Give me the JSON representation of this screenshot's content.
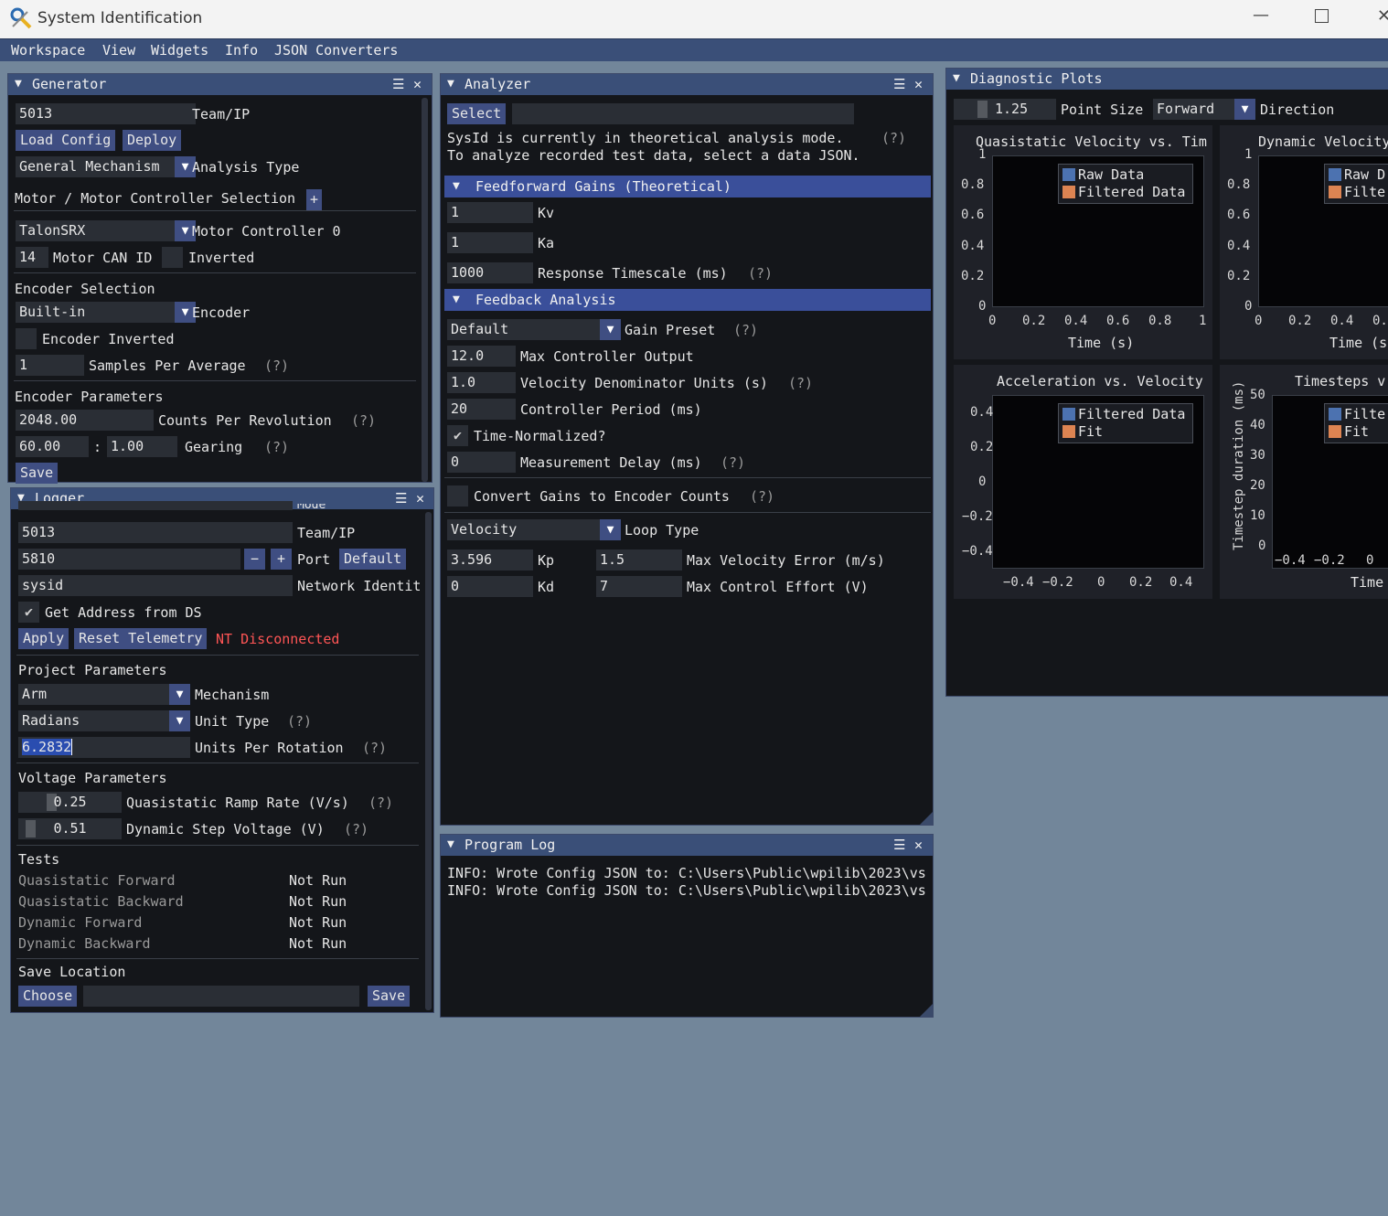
{
  "app": {
    "title": "System Identification"
  },
  "menu": [
    "Workspace",
    "View",
    "Widgets",
    "Info",
    "JSON Converters"
  ],
  "colors": {
    "accent": "#3a4f78",
    "button": "#3f4e82",
    "raw_series": "#4c72b0",
    "filtered_series": "#dd8452",
    "error_text": "#ff5555"
  },
  "generator": {
    "title": "Generator",
    "team_value": "5013",
    "team_label": "Team/IP",
    "load_config": "Load Config",
    "deploy": "Deploy",
    "analysis_type_value": "General Mechanism",
    "analysis_type_label": "Analysis Type",
    "motor_section": "Motor / Motor Controller Selection",
    "add": "+",
    "motor_controller_value": "TalonSRX",
    "motor_controller_label": "Motor Controller 0",
    "can_id_value": "14",
    "can_id_label": "Motor CAN ID",
    "inverted_label": "Inverted",
    "encoder_section": "Encoder Selection",
    "encoder_value": "Built-in",
    "encoder_label": "Encoder",
    "encoder_inverted_label": "Encoder Inverted",
    "samples_value": "1",
    "samples_label": "Samples Per Average",
    "help": "(?)",
    "encoder_params": "Encoder Parameters",
    "cpr_value": "2048.00",
    "cpr_label": "Counts Per Revolution",
    "gear_a": "60.00",
    "gear_sep": ":",
    "gear_b": "1.00",
    "gearing_label": "Gearing",
    "save": "Save"
  },
  "logger": {
    "title": "Logger",
    "partial_text": "Mode",
    "team_value": "5013",
    "team_label": "Team/IP",
    "port_value": "5810",
    "minus": "−",
    "plus": "+",
    "port_label": "Port",
    "default": "Default",
    "nt_value": "sysid",
    "nt_label": "Network Identit",
    "ds_label": "Get Address from DS",
    "apply": "Apply",
    "reset": "Reset Telemetry",
    "nt_status": "NT Disconnected",
    "project_params": "Project Parameters",
    "mechanism_value": "Arm",
    "mechanism_label": "Mechanism",
    "unit_type_value": "Radians",
    "unit_type_label": "Unit Type",
    "help": "(?)",
    "upr_value": "6.2832",
    "upr_label": "Units Per Rotation",
    "voltage_params": "Voltage Parameters",
    "ramp_value": "0.25",
    "ramp_label": "Quasistatic Ramp Rate (V/s)",
    "step_value": "0.51",
    "step_label": "Dynamic Step Voltage (V)",
    "tests_label": "Tests",
    "tests": [
      {
        "name": "Quasistatic Forward",
        "status": "Not Run"
      },
      {
        "name": "Quasistatic Backward",
        "status": "Not Run"
      },
      {
        "name": "Dynamic Forward",
        "status": "Not Run"
      },
      {
        "name": "Dynamic Backward",
        "status": "Not Run"
      }
    ],
    "save_location": "Save Location",
    "choose": "Choose",
    "save": "Save"
  },
  "analyzer": {
    "title": "Analyzer",
    "select": "Select",
    "mode_line1": "SysId is currently in theoretical analysis mode.",
    "mode_line2": "To analyze recorded test data, select a data JSON.",
    "help": "(?)",
    "ff_header": "Feedforward Gains (Theoretical)",
    "kv_value": "1",
    "kv_label": "Kv",
    "ka_value": "1",
    "ka_label": "Ka",
    "rt_value": "1000",
    "rt_label": "Response Timescale (ms)",
    "fb_header": "Feedback Analysis",
    "preset_value": "Default",
    "preset_label": "Gain Preset",
    "mco_value": "12.0",
    "mco_label": "Max Controller Output",
    "vdu_value": "1.0",
    "vdu_label": "Velocity Denominator Units (s)",
    "cp_value": "20",
    "cp_label": "Controller Period (ms)",
    "tn_label": "Time-Normalized?",
    "md_value": "0",
    "md_label": "Measurement Delay (ms)",
    "convert_label": "Convert Gains to Encoder Counts",
    "loop_value": "Velocity",
    "loop_label": "Loop Type",
    "kp_value": "3.596",
    "kp_label": "Kp",
    "mve_value": "1.5",
    "mve_label": "Max Velocity Error (m/s)",
    "kd_value": "0",
    "kd_label": "Kd",
    "mce_value": "7",
    "mce_label": "Max Control Effort (V)"
  },
  "program_log": {
    "title": "Program Log",
    "lines": [
      "INFO: Wrote Config JSON to: C:\\Users\\Public\\wpilib\\2023\\vs",
      "INFO: Wrote Config JSON to: C:\\Users\\Public\\wpilib\\2023\\vs"
    ]
  },
  "diagnostics": {
    "title": "Diagnostic Plots",
    "point_size_value": "1.25",
    "point_size_label": "Point Size",
    "direction_value": "Forward",
    "direction_label": "Direction",
    "plots": [
      {
        "title": "Quasistatic Velocity vs. Tim",
        "xlabel": "Time (s)",
        "xticks": [
          "0",
          "0.2",
          "0.4",
          "0.6",
          "0.8",
          "1"
        ],
        "yticks": [
          "1",
          "0.8",
          "0.6",
          "0.4",
          "0.2",
          "0"
        ],
        "legend": [
          "Raw Data",
          "Filtered Data"
        ]
      },
      {
        "title": "Dynamic Velocity",
        "xlabel": "Time (s",
        "xticks": [
          "0",
          "0.2",
          "0.4",
          "0."
        ],
        "yticks": [
          "1",
          "0.8",
          "0.6",
          "0.4",
          "0.2",
          "0"
        ],
        "legend": [
          "Raw D",
          "Filte"
        ]
      },
      {
        "title": "Acceleration vs. Velocity",
        "xlabel": "",
        "xticks": [
          "−0.4",
          "−0.2",
          "0",
          "0.2",
          "0.4"
        ],
        "yticks": [
          "0.4",
          "0.2",
          "0",
          "−0.2",
          "−0.4"
        ],
        "legend": [
          "Filtered Data",
          "Fit"
        ]
      },
      {
        "title": "Timesteps v",
        "xlabel": "Time (",
        "ylabel": "Timestep duration (ms)",
        "xticks": [
          "−0.4",
          "−0.2",
          "0"
        ],
        "yticks": [
          "50",
          "40",
          "30",
          "20",
          "10",
          "0"
        ],
        "legend": [
          "Filte",
          "Fit"
        ]
      }
    ]
  }
}
